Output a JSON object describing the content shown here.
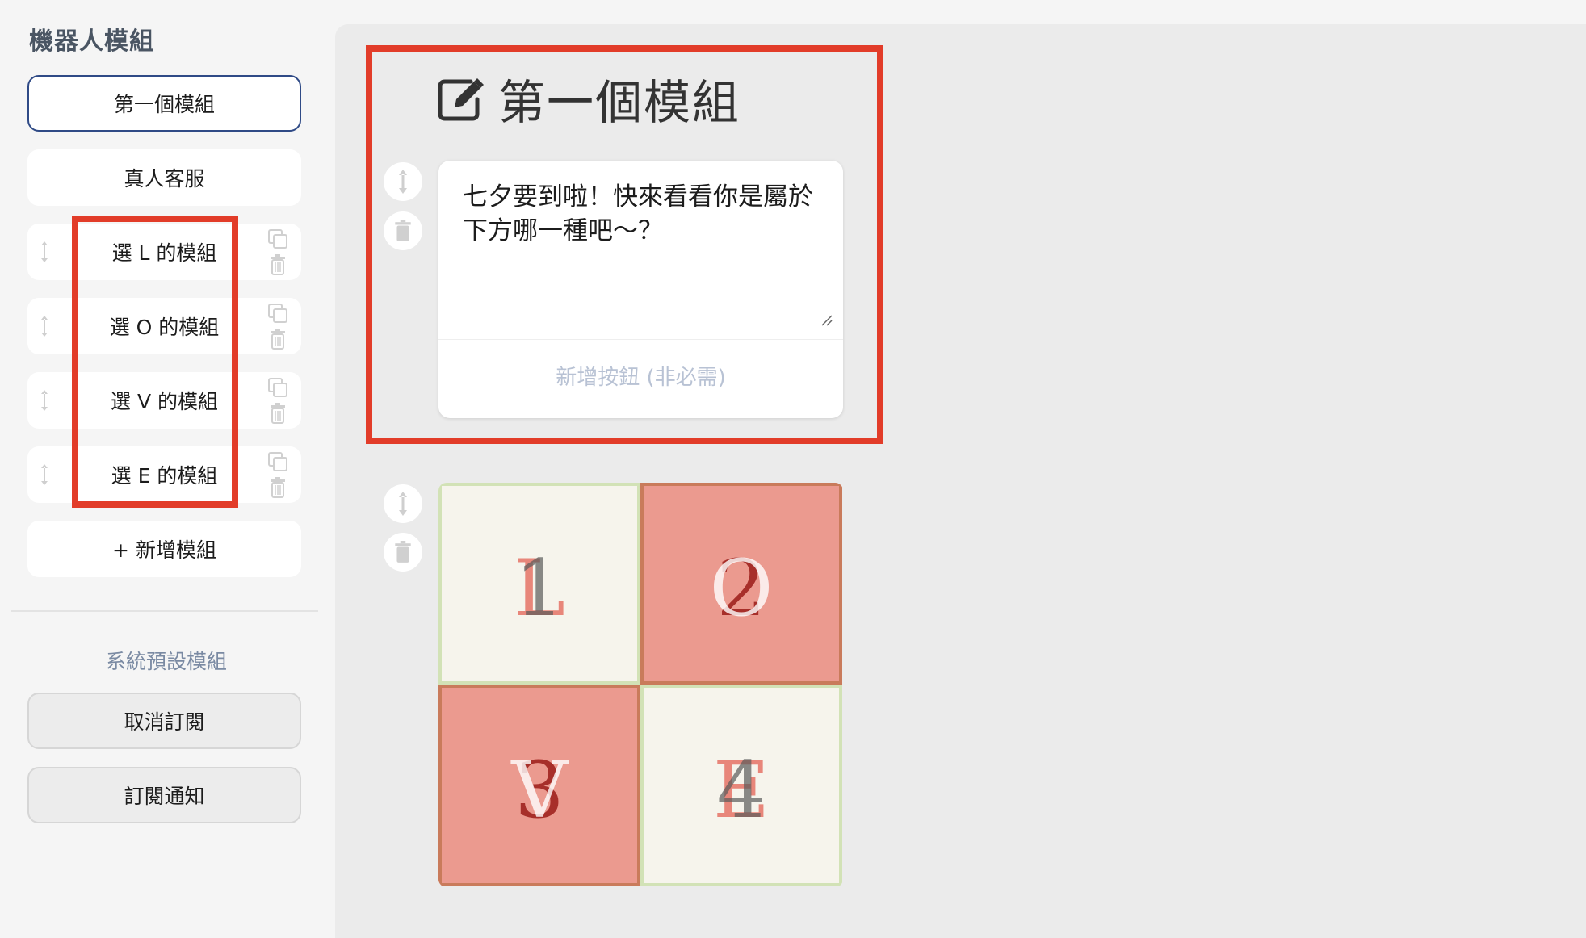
{
  "sidebar": {
    "title": "機器人模組",
    "modules": [
      {
        "label": "第一個模組",
        "active": true,
        "tools": false
      },
      {
        "label": "真人客服",
        "active": false,
        "tools": false
      },
      {
        "label": "選 L 的模組",
        "active": false,
        "tools": true
      },
      {
        "label": "選 O 的模組",
        "active": false,
        "tools": true
      },
      {
        "label": "選 V 的模組",
        "active": false,
        "tools": true
      },
      {
        "label": "選 E 的模組",
        "active": false,
        "tools": true
      }
    ],
    "add_module_label": "+ 新增模組",
    "system_section_title": "系統預設模組",
    "system_modules": [
      "取消訂閱",
      "訂閱通知"
    ]
  },
  "main": {
    "module_title": "第一個模組",
    "text_card": {
      "message": "七夕要到啦！快來看看你是屬於下方哪一種吧～？",
      "add_button_label": "新增按鈕 (非必需)"
    },
    "image_grid": {
      "cells": [
        {
          "number": "1",
          "letter": "L",
          "style": "light"
        },
        {
          "number": "2",
          "letter": "O",
          "style": "pink"
        },
        {
          "number": "3",
          "letter": "V",
          "style": "pink"
        },
        {
          "number": "4",
          "letter": "E",
          "style": "light"
        }
      ]
    }
  },
  "colors": {
    "highlight_red": "#e23c29",
    "active_border": "#2f4a86",
    "pink_cell": "#eb9a8f",
    "light_cell": "#f6f4ec"
  }
}
